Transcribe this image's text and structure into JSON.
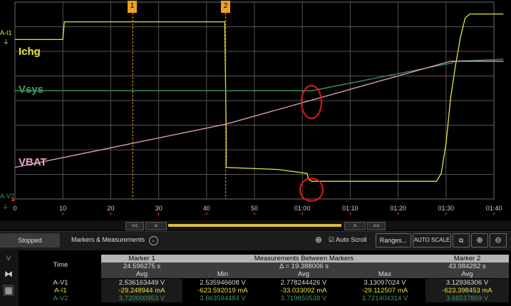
{
  "chart_data": {
    "type": "line",
    "x_ticks": [
      "0",
      "10",
      "20",
      "30",
      "40",
      "50",
      "01:00",
      "01:10",
      "01:20",
      "01:30",
      "01:40"
    ],
    "markers": [
      {
        "label": "1",
        "time_s": 24.6
      },
      {
        "label": "2",
        "time_s": 44.0
      }
    ],
    "series": [
      {
        "name": "Ichg",
        "color": "#e8e23a",
        "points": [
          [
            0,
            0.81
          ],
          [
            10,
            0.81
          ],
          [
            10.3,
            0.9
          ],
          [
            43.8,
            0.9
          ],
          [
            44.1,
            0.33
          ],
          [
            44.1,
            0.16
          ],
          [
            55,
            0.15
          ],
          [
            61,
            0.13
          ],
          [
            61.3,
            0.1
          ],
          [
            62,
            0.09
          ],
          [
            85,
            0.09
          ],
          [
            88,
            0.09
          ],
          [
            89,
            0.13
          ],
          [
            90,
            0.28
          ],
          [
            91,
            0.52
          ],
          [
            92,
            0.68
          ],
          [
            93,
            0.82
          ],
          [
            94,
            0.92
          ],
          [
            95,
            0.94
          ],
          [
            102,
            0.94
          ]
        ]
      },
      {
        "name": "Vsys",
        "color": "#3f9a5e",
        "points": [
          [
            0,
            0.55
          ],
          [
            62,
            0.55
          ],
          [
            91,
            0.69
          ],
          [
            92,
            0.7
          ],
          [
            102,
            0.71
          ]
        ]
      },
      {
        "name": "VBAT",
        "color": "#e8a3c8",
        "points": [
          [
            0,
            0.16
          ],
          [
            44,
            0.38
          ],
          [
            91,
            0.7
          ],
          [
            102,
            0.7
          ]
        ]
      }
    ]
  },
  "plot_labels": {
    "ichg": "Ichg",
    "vsys": "Vsys",
    "vbat": "VBAT",
    "ch_i1": "A-I1",
    "ch_v2": "A-V2"
  },
  "plus_sign": "+",
  "marker_flags": {
    "m1": "1",
    "m2": "2"
  },
  "scrollbar": {
    "left_left": "<<",
    "left": "<",
    "right": ">",
    "right_right": ">>"
  },
  "toolbar": {
    "status": "Stopped",
    "markers_menu": "Markers & Measurements",
    "auto_scroll": "Auto Scroll",
    "auto_scroll_checked": "☑",
    "ranges": "Ranges...",
    "auto_scale": "AUTO SCALE"
  },
  "colors": {
    "ichg": "#e8e23a",
    "vsys": "#3f9a5e",
    "vbat": "#e8a3c8",
    "marker": "#f0a020"
  },
  "table": {
    "time_label": "Time",
    "marker1_header": "Marker 1",
    "between_header": "Measurements Between Markers",
    "marker2_header": "Marker 2",
    "marker1_time": "24.596275 s",
    "delta": "Δ = 19.388006 s",
    "marker2_time": "43.984282 s",
    "col_avg1": "Avg",
    "col_min": "Min",
    "col_avg": "Avg",
    "col_max": "Max",
    "col_avg2": "Avg",
    "rows": [
      {
        "name": "A-V1",
        "m1": "2.536163449 V",
        "min": "2.535946608 V",
        "avg": "2.778244426 V",
        "max": "3.13097024 V",
        "m2": "3.12936306 V"
      },
      {
        "name": "A-I1",
        "m1": "-29.248944 mA",
        "min": "-623.592019 mA",
        "avg": "-33.033092 mA",
        "max": "-29.112507 mA",
        "m2": "-623.398453 mA"
      },
      {
        "name": "A-V2",
        "m1": "3.720000953 V",
        "min": "3.663594484 V",
        "avg": "3.719850538 V",
        "max": "3.721404314 V",
        "m2": "3.66537869 V"
      }
    ]
  }
}
